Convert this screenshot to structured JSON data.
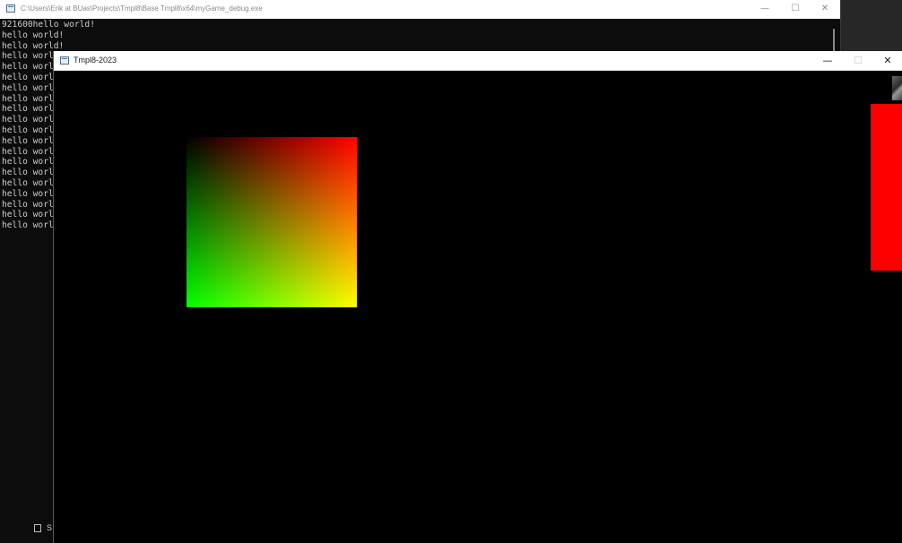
{
  "console_window": {
    "title": "C:\\Users\\Erik at BUas\\Projects\\Tmpl8\\Base Tmpl8\\x64\\myGame_debug.exe",
    "controls": {
      "minimize": "—",
      "maximize": "☐",
      "close": "✕"
    },
    "output_lines": [
      "921600hello world!",
      "hello world!",
      "hello world!",
      "hello worl",
      "hello worl",
      "hello worl",
      "hello worl",
      "hello worl",
      "hello worl",
      "hello worl",
      "hello worl",
      "hello worl",
      "hello worl",
      "hello worl",
      "hello worl",
      "hello worl",
      "hello worl",
      "hello worl",
      "hello worl",
      "hello worl"
    ],
    "footer_text": "S"
  },
  "game_window": {
    "title": "Tmpl8-2023",
    "controls": {
      "minimize": "—",
      "maximize": "☐",
      "close": "✕"
    },
    "colors": {
      "background": "#000000",
      "red_rect": "#ff0000",
      "gradient_top_left": "#000000",
      "gradient_top_right": "#ff0000",
      "gradient_bottom_left": "#00ff00",
      "gradient_bottom_right": "#ffff00"
    }
  }
}
